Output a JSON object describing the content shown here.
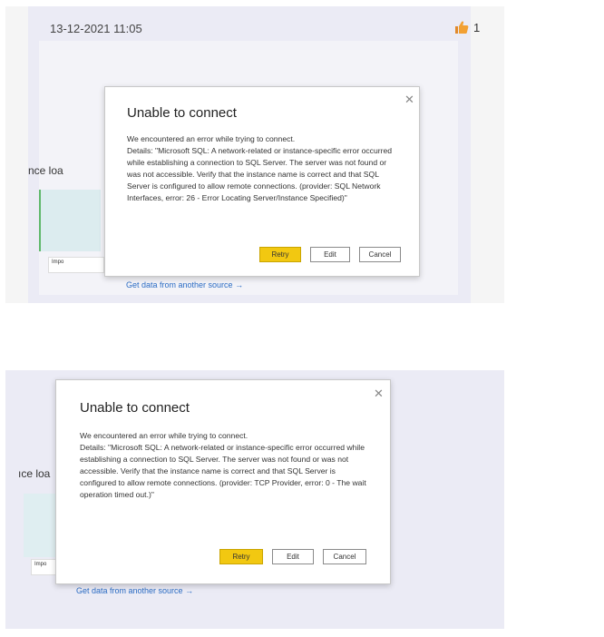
{
  "message": {
    "timestamp": "13-12-2021 11:05",
    "reaction_icon": "thumbs-up-icon",
    "reaction_count": "1",
    "accent_color": "#f2a033"
  },
  "dialogs": [
    {
      "title": "Unable to connect",
      "intro": "We encountered an error while trying to connect.",
      "details": "Details: \"Microsoft SQL: A network-related or instance-specific error occurred while establishing a connection to SQL Server. The server was not found or was not accessible. Verify that the instance name is correct and that SQL Server is configured to allow remote connections. (provider: SQL Network Interfaces, error: 26 - Error Locating Server/Instance Specified)\"",
      "buttons": {
        "retry": "Retry",
        "edit": "Edit",
        "cancel": "Cancel"
      },
      "background": {
        "partial_text": "nce loa",
        "tile_label": "Impo",
        "link": "Get data from another source →"
      }
    },
    {
      "title": "Unable to connect",
      "intro": "We encountered an error while trying to connect.",
      "details": "Details: \"Microsoft SQL: A network-related or instance-specific error occurred while establishing a connection to SQL Server. The server was not found or was not accessible. Verify that the instance name is correct and that SQL Server is configured to allow remote connections. (provider: TCP Provider, error: 0 - The wait operation timed out.)\"",
      "buttons": {
        "retry": "Retry",
        "edit": "Edit",
        "cancel": "Cancel"
      },
      "background": {
        "partial_text": "ıce loa",
        "tile_label": "Impo",
        "link": "Get data from another source →"
      }
    }
  ],
  "colors": {
    "retry_button": "#f2c811",
    "link": "#2b6cc4",
    "panel_background": "#ebebf5"
  }
}
